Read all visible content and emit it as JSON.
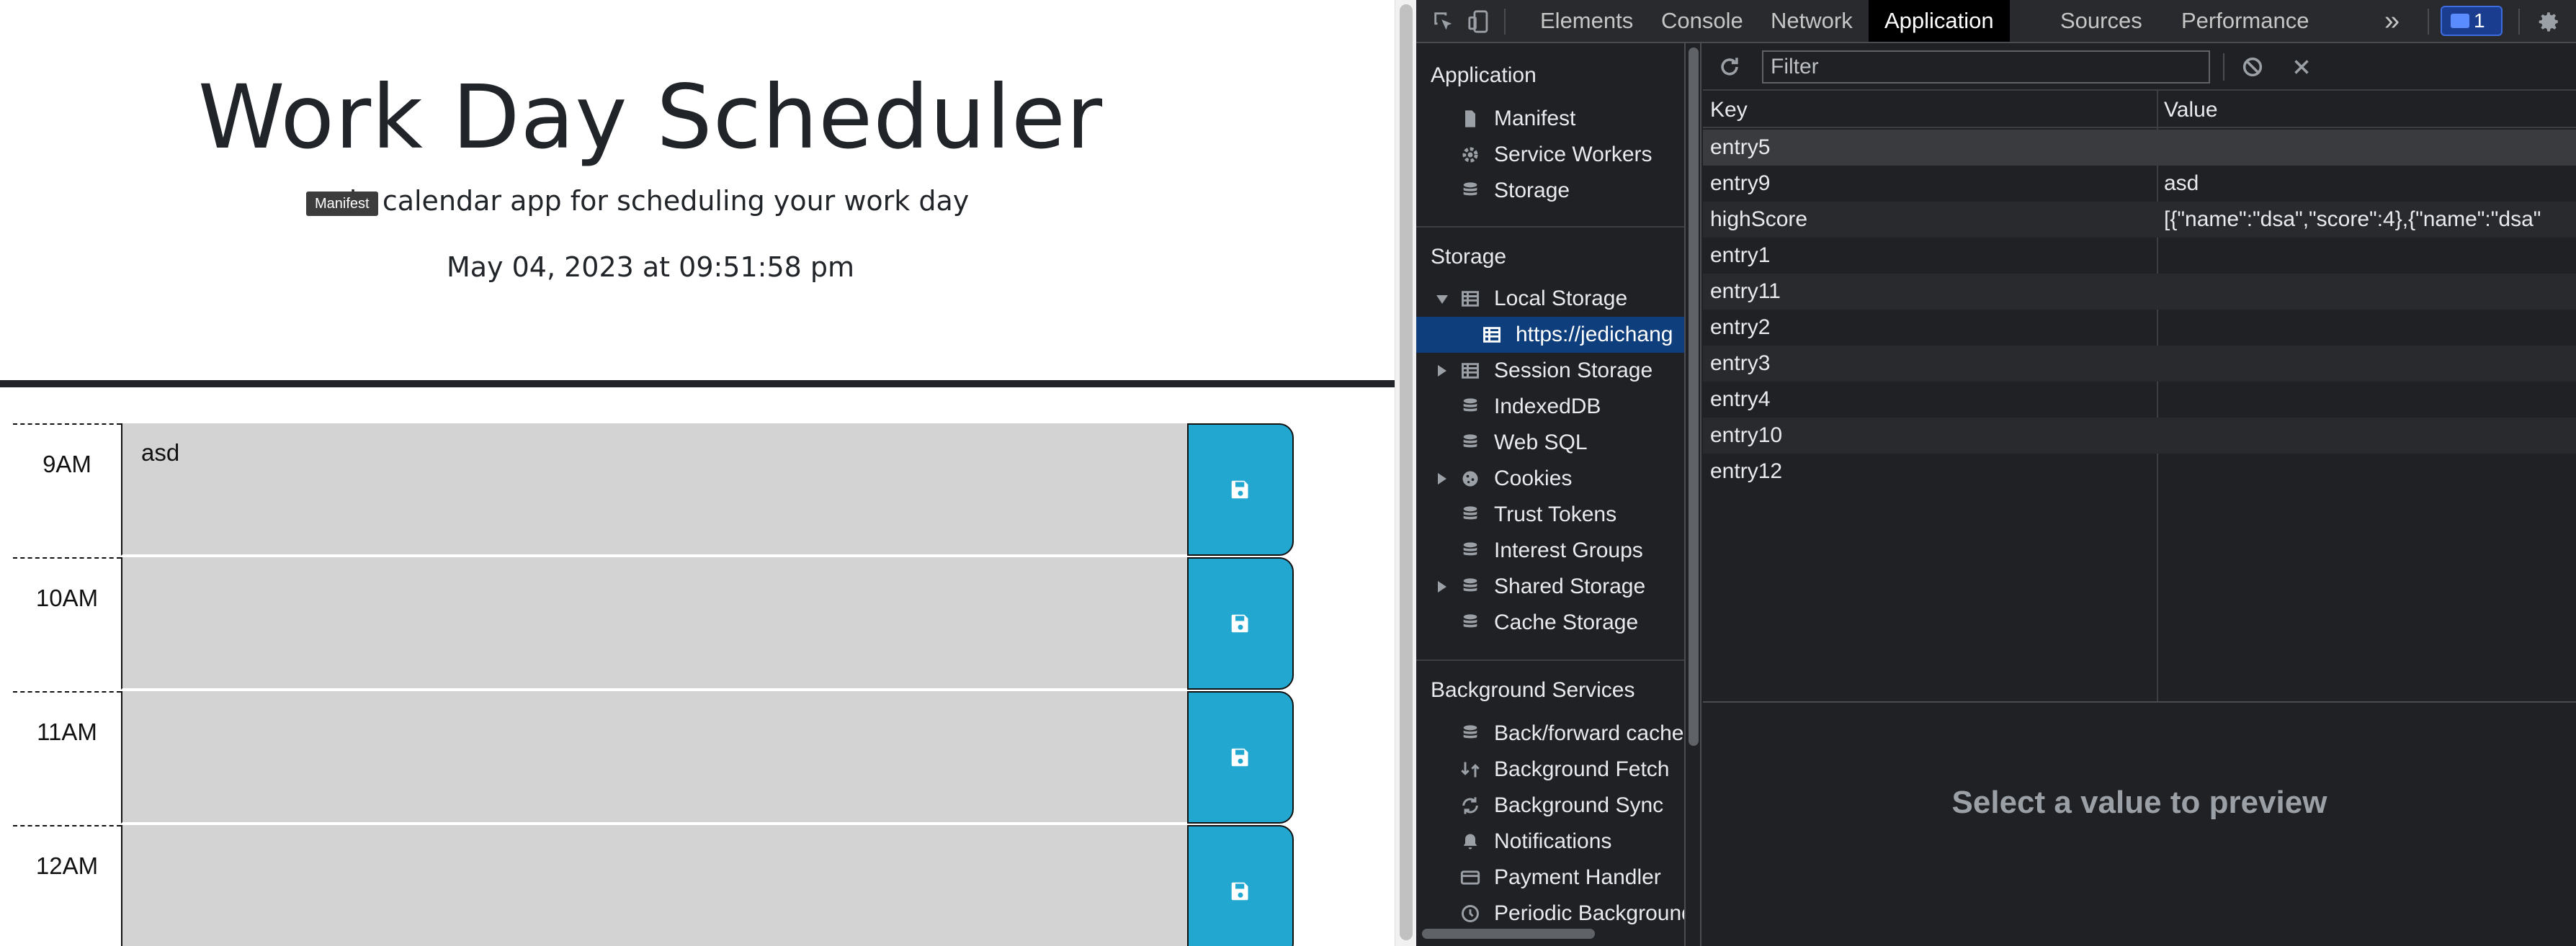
{
  "app": {
    "title": "Work Day Scheduler",
    "subtitle": "ple calendar app for scheduling your work day",
    "datetime": "May 04, 2023 at 09:51:58 pm",
    "tooltip": "Manifest",
    "rows": [
      {
        "hour": "9AM",
        "text": "asd"
      },
      {
        "hour": "10AM",
        "text": ""
      },
      {
        "hour": "11AM",
        "text": ""
      },
      {
        "hour": "12AM",
        "text": ""
      }
    ]
  },
  "devtools": {
    "tabs": [
      "Elements",
      "Console",
      "Network",
      "Application",
      "Sources",
      "Performance"
    ],
    "active_tab": "Application",
    "more_label": "»",
    "issues_count": "1",
    "sidebar": {
      "application_title": "Application",
      "application_items": [
        "Manifest",
        "Service Workers",
        "Storage"
      ],
      "storage_title": "Storage",
      "storage_items": [
        "Local Storage",
        "https://jedichang",
        "Session Storage",
        "IndexedDB",
        "Web SQL",
        "Cookies",
        "Trust Tokens",
        "Interest Groups",
        "Shared Storage",
        "Cache Storage"
      ],
      "background_title": "Background Services",
      "background_items": [
        "Back/forward cache",
        "Background Fetch",
        "Background Sync",
        "Notifications",
        "Payment Handler",
        "Periodic Background"
      ]
    },
    "filter_placeholder": "Filter",
    "table": {
      "key_header": "Key",
      "value_header": "Value",
      "rows": [
        {
          "key": "entry5",
          "value": ""
        },
        {
          "key": "entry9",
          "value": "asd"
        },
        {
          "key": "highScore",
          "value": "[{\"name\":\"dsa\",\"score\":4},{\"name\":\"dsa\""
        },
        {
          "key": "entry1",
          "value": ""
        },
        {
          "key": "entry11",
          "value": ""
        },
        {
          "key": "entry2",
          "value": ""
        },
        {
          "key": "entry3",
          "value": ""
        },
        {
          "key": "entry4",
          "value": ""
        },
        {
          "key": "entry10",
          "value": ""
        },
        {
          "key": "entry12",
          "value": ""
        }
      ]
    },
    "preview_text": "Select a value to preview",
    "colors": {
      "accent": "#0e3e7c",
      "save_button": "#22a7d0"
    }
  }
}
